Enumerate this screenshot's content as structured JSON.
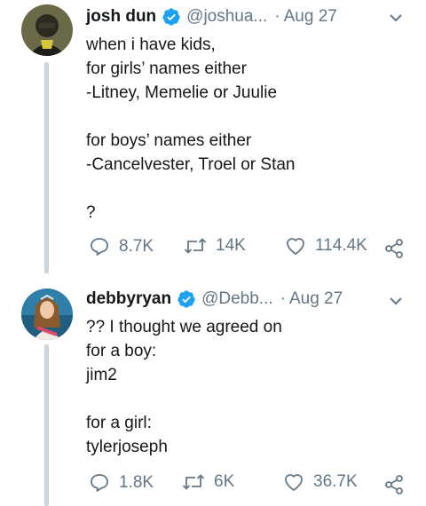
{
  "tweets": [
    {
      "author_name": "josh dun",
      "handle": "@joshua...",
      "separator": "·",
      "date": "Aug 27",
      "text": "when i have kids,\nfor girls’ names either\n-Litney, Memelie or Juulie\n\nfor boys’ names either\n-Cancelvester, Troel or Stan\n\n?",
      "replies": "8.7K",
      "retweets": "14K",
      "likes": "114.4K"
    },
    {
      "author_name": "debbyryan",
      "handle": "@Debb...",
      "separator": "·",
      "date": "Aug 27",
      "text": "?? I thought we agreed on\nfor a boy:\njim2\n\nfor a girl:\ntylerjoseph",
      "replies": "1.8K",
      "retweets": "6K",
      "likes": "36.7K"
    }
  ],
  "colors": {
    "verified": "#1da1f2",
    "muted": "#657786",
    "thread_line": "#ccd6dd"
  },
  "icons": [
    "verified-badge-icon",
    "chevron-down-icon",
    "reply-icon",
    "retweet-icon",
    "like-icon",
    "share-icon"
  ]
}
